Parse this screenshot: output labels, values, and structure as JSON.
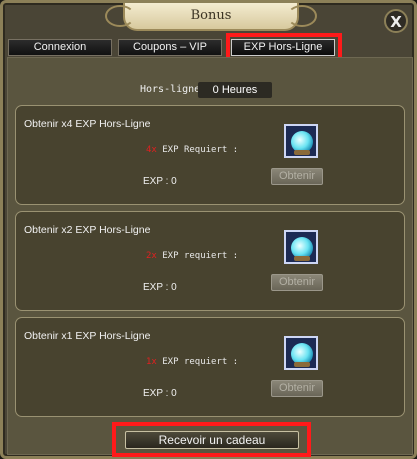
{
  "window": {
    "title": "Bonus",
    "close_glyph": "X"
  },
  "tabs": [
    {
      "label": "Connexion",
      "active": false
    },
    {
      "label": "Coupons – VIP",
      "active": false
    },
    {
      "label": "EXP Hors-Ligne",
      "active": true
    }
  ],
  "offline": {
    "label": "Hors-ligne",
    "value": "0 Heures"
  },
  "cards": [
    {
      "title": "Obtenir x4 EXP Hors-Ligne",
      "multiplier": "4x",
      "requirement": "EXP Requiert :",
      "exp": "EXP : 0",
      "button": "Obtenir",
      "icon": "orb-icon"
    },
    {
      "title": "Obtenir x2 EXP Hors-Ligne",
      "multiplier": "2x",
      "requirement": "EXP requiert :",
      "exp": "EXP : 0",
      "button": "Obtenir",
      "icon": "orb-icon"
    },
    {
      "title": "Obtenir x1 EXP Hors-Ligne",
      "multiplier": "1x",
      "requirement": "EXP requiert :",
      "exp": "EXP : 0",
      "button": "Obtenir",
      "icon": "orb-icon"
    }
  ],
  "gift_button": "Recevoir un cadeau",
  "colors": {
    "highlight": "#ff1a1a",
    "multiplier": "#e02020",
    "panel": "#5a553f"
  }
}
